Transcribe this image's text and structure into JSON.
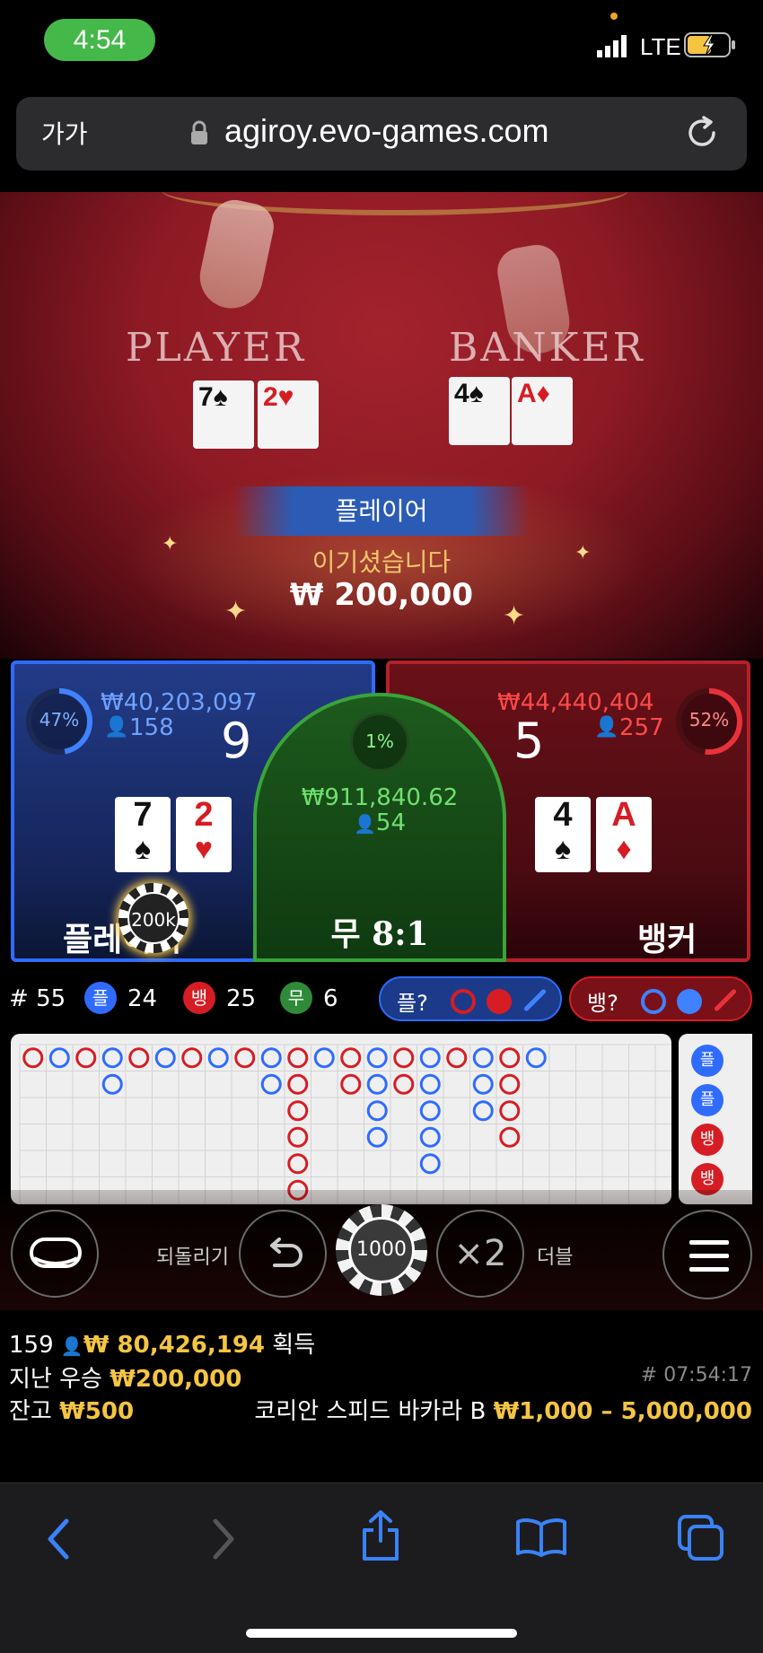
{
  "status_bar": {
    "time": "4:54",
    "network": "LTE"
  },
  "browser": {
    "text_size_label": "가가",
    "url": "agiroy.evo-games.com"
  },
  "table_felt": {
    "player_label": "PLAYER",
    "banker_label": "BANKER"
  },
  "video_cards": {
    "player": [
      {
        "rank": "7",
        "suit": "♠"
      },
      {
        "rank": "2",
        "suit": "♥"
      }
    ],
    "banker": [
      {
        "rank": "4",
        "suit": "♠"
      },
      {
        "rank": "A",
        "suit": "♦"
      }
    ]
  },
  "win_banner": {
    "side": "플레이어",
    "message": "이기셨습니다",
    "amount": "₩ 200,000"
  },
  "player_panel": {
    "percent": "47%",
    "percent_value": 47,
    "total": "₩40,203,097",
    "bettors": "158",
    "score": "9",
    "label": "플레이어",
    "cards": [
      {
        "rank": "7",
        "suit": "♠",
        "color": "#111111"
      },
      {
        "rank": "2",
        "suit": "♥",
        "color": "#d61d24"
      }
    ],
    "chip": "200k"
  },
  "tie_panel": {
    "percent": "1%",
    "total": "₩911,840.62",
    "bettors": "54",
    "label": "무",
    "odds": "8:1"
  },
  "banker_panel": {
    "percent": "52%",
    "percent_value": 52,
    "total": "₩44,440,404",
    "bettors": "257",
    "score": "5",
    "label": "뱅커",
    "cards": [
      {
        "rank": "4",
        "suit": "♠",
        "color": "#111111"
      },
      {
        "rank": "A",
        "suit": "♦",
        "color": "#d61d24"
      }
    ]
  },
  "stats": {
    "round_prefix": "#",
    "round": "55",
    "player_badge": "플",
    "player_count": "24",
    "banker_badge": "뱅",
    "banker_count": "25",
    "tie_badge": "무",
    "tie_count": "6",
    "player_predict": "플?",
    "banker_predict": "뱅?"
  },
  "roadmap": {
    "columns": [
      [
        "R"
      ],
      [
        "B"
      ],
      [
        "R"
      ],
      [
        "B",
        "B"
      ],
      [
        "R"
      ],
      [
        "B"
      ],
      [
        "R"
      ],
      [
        "B"
      ],
      [
        "R"
      ],
      [
        "B",
        "B"
      ],
      [
        "R",
        "R",
        "R",
        "R",
        "R",
        "R"
      ],
      [
        "B"
      ],
      [
        "R",
        "R"
      ],
      [
        "B",
        "B",
        "B",
        "B"
      ],
      [
        "R",
        "R"
      ],
      [
        "B",
        "B",
        "B",
        "B",
        "B"
      ],
      [
        "R"
      ],
      [
        "B",
        "B",
        "B"
      ],
      [
        "R",
        "R",
        "R",
        "R"
      ],
      [
        "B"
      ]
    ],
    "side_badges": [
      "플",
      "플",
      "뱅",
      "뱅"
    ]
  },
  "controls": {
    "undo_label": "되돌리기",
    "chip_value": "1000",
    "double_symbol": "×2",
    "double_label": "더블"
  },
  "info": {
    "winners_count": "159",
    "winners_amount": "₩ 80,426,194",
    "winners_suffix": "획득",
    "last_win_label": "지난 우승",
    "last_win_amount": "₩200,000",
    "timestamp": "# 07:54:17",
    "balance_label": "잔고",
    "balance_amount": "₩500",
    "table_name": "코리안 스피드 바카라 B",
    "bet_limits": "₩1,000 – 5,000,000"
  },
  "colors": {
    "player": "#2f6bff",
    "banker": "#d61d24",
    "tie": "#3aa33a",
    "gold": "#f5c542",
    "browser_accent": "#3a82f7"
  }
}
